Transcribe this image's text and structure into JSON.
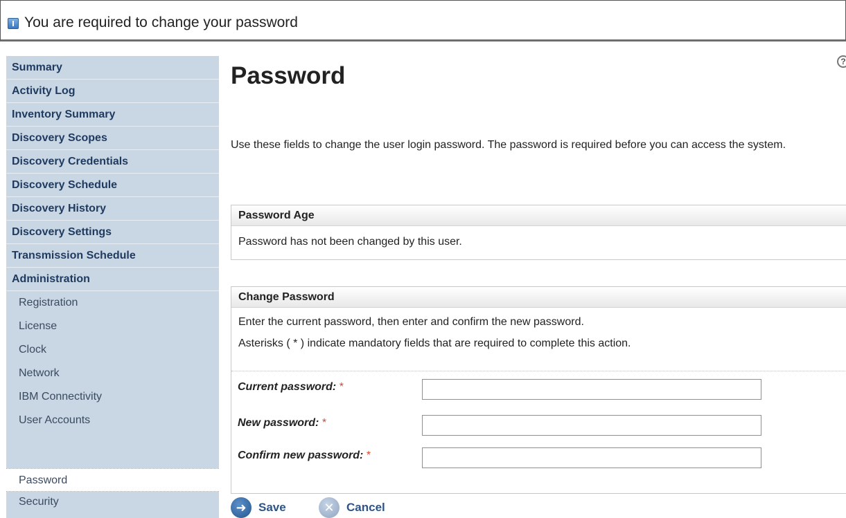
{
  "banner": {
    "message": "You are required to change your password",
    "icon": "info-icon"
  },
  "sidebar": {
    "items": [
      {
        "label": "Summary"
      },
      {
        "label": "Activity Log"
      },
      {
        "label": "Inventory Summary"
      },
      {
        "label": "Discovery Scopes"
      },
      {
        "label": "Discovery Credentials"
      },
      {
        "label": "Discovery Schedule"
      },
      {
        "label": "Discovery History"
      },
      {
        "label": "Discovery Settings"
      },
      {
        "label": "Transmission Schedule"
      },
      {
        "label": "Administration"
      }
    ],
    "sub_items": [
      {
        "label": "Registration"
      },
      {
        "label": "License"
      },
      {
        "label": "Clock"
      },
      {
        "label": "Network"
      },
      {
        "label": "IBM Connectivity"
      },
      {
        "label": "User Accounts"
      },
      {
        "label": "Password",
        "selected": true
      },
      {
        "label": "Security"
      }
    ]
  },
  "main": {
    "title": "Password",
    "help_icon": "help-icon",
    "intro": "Use these fields to change the user login password. The password is required before you can access the system.",
    "password_age": {
      "heading": "Password Age",
      "text": "Password has not been changed by this user."
    },
    "change_password": {
      "heading": "Change Password",
      "instructions": "Enter the current password, then enter and confirm the new password.",
      "asterisk_note": "Asterisks ( * ) indicate mandatory fields that are required to complete this action.",
      "required_marker": "*",
      "fields": [
        {
          "label": "Current password:",
          "value": ""
        },
        {
          "label": "New password:",
          "value": ""
        },
        {
          "label": "Confirm new password:",
          "value": ""
        }
      ]
    },
    "actions": {
      "save_label": "Save",
      "cancel_label": "Cancel"
    }
  },
  "colors": {
    "sidebar_bg": "#c9d6e4",
    "nav_text": "#1f3a5f",
    "required": "#d24a2e",
    "button_text": "#2e5486"
  }
}
